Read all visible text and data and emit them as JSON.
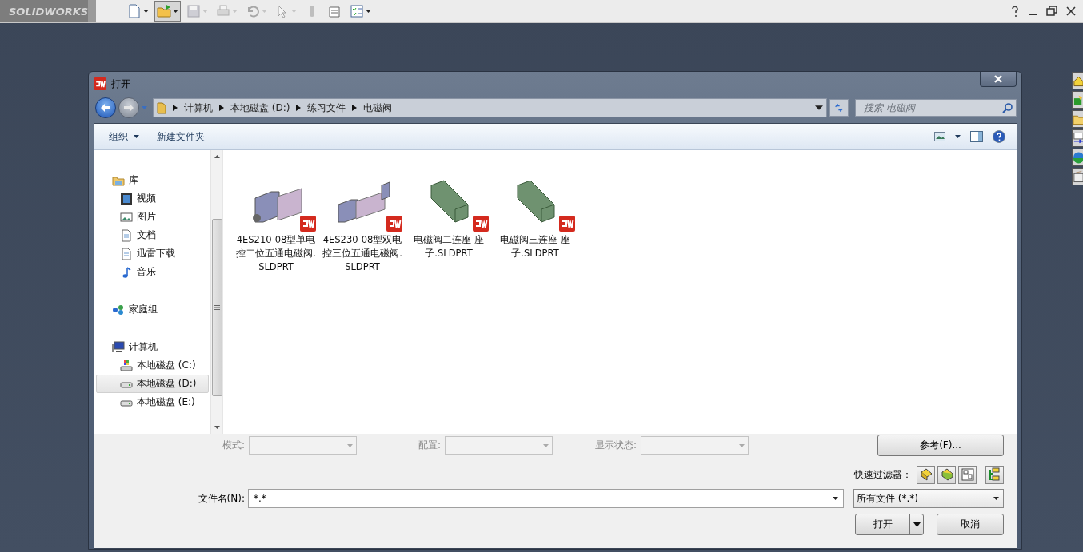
{
  "app_toolbar": {
    "logo_text": "SOLIDWORKS",
    "tools": [
      {
        "kind": "new",
        "dropdown": true,
        "pressed": false,
        "disabled": false
      },
      {
        "kind": "open",
        "dropdown": true,
        "pressed": true,
        "disabled": false
      },
      {
        "kind": "save",
        "dropdown": true,
        "pressed": false,
        "disabled": true
      },
      {
        "kind": "print",
        "dropdown": true,
        "pressed": false,
        "disabled": true
      },
      {
        "kind": "undo",
        "dropdown": true,
        "pressed": false,
        "disabled": true
      },
      {
        "kind": "select",
        "dropdown": true,
        "pressed": false,
        "disabled": true
      },
      {
        "kind": "rebuild",
        "dropdown": false,
        "pressed": false,
        "disabled": true
      },
      {
        "kind": "properties",
        "dropdown": false,
        "pressed": false,
        "disabled": false
      },
      {
        "kind": "options",
        "dropdown": true,
        "pressed": false,
        "disabled": false
      }
    ]
  },
  "dialog": {
    "title": "打开",
    "breadcrumb": [
      "计算机",
      "本地磁盘 (D:)",
      "练习文件",
      "电磁阀"
    ],
    "search": {
      "placeholder": "搜索 电磁阀"
    },
    "commands": [
      {
        "label": "组织",
        "dropdown": true
      },
      {
        "label": "新建文件夹",
        "dropdown": false
      }
    ],
    "sidebar": [
      {
        "label": "库",
        "kind": "library",
        "selected": false,
        "children": [
          {
            "label": "视频",
            "kind": "video",
            "selected": false
          },
          {
            "label": "图片",
            "kind": "picture",
            "selected": false
          },
          {
            "label": "文档",
            "kind": "document",
            "selected": false
          },
          {
            "label": "迅雷下载",
            "kind": "document",
            "selected": false
          },
          {
            "label": "音乐",
            "kind": "music",
            "selected": false
          }
        ]
      },
      {
        "label": "家庭组",
        "kind": "homegroup",
        "selected": false
      },
      {
        "label": "计算机",
        "kind": "computer",
        "selected": false,
        "children": [
          {
            "label": "本地磁盘 (C:)",
            "kind": "system-drive",
            "selected": false
          },
          {
            "label": "本地磁盘 (D:)",
            "kind": "drive",
            "selected": true
          },
          {
            "label": "本地磁盘 (E:)",
            "kind": "drive",
            "selected": false
          }
        ]
      }
    ],
    "files": [
      {
        "name": "4ES210-08型单电控二位五通电磁阀.SLDPRT",
        "kind": "valve"
      },
      {
        "name": "4ES230-08型双电控三位五通电磁阀.SLDPRT",
        "kind": "double-valve"
      },
      {
        "name": "电磁阀二连座  座子.SLDPRT",
        "kind": "base"
      },
      {
        "name": "电磁阀三连座  座子.SLDPRT",
        "kind": "base"
      }
    ],
    "options": [
      {
        "label": "模式:",
        "disabled": true
      },
      {
        "label": "配置:",
        "disabled": true
      },
      {
        "label": "显示状态:",
        "disabled": true
      }
    ],
    "references_button": "参考(F)...",
    "quick_filter_label": "快速过滤器：",
    "file_name": {
      "label": "文件名(N):",
      "value": "*.*"
    },
    "file_type": "所有文件 (*.*)",
    "open_button": "打开",
    "cancel_button": "取消"
  }
}
